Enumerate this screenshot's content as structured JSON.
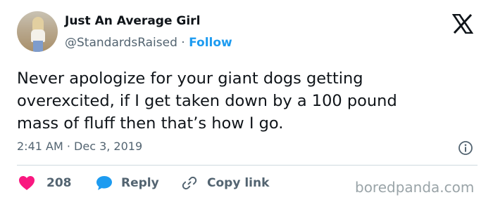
{
  "author": {
    "display_name": "Just An Average Girl",
    "handle": "@StandardsRaised",
    "separator": "·",
    "follow_label": "Follow",
    "avatar_icon": "profile-photo"
  },
  "tweet": {
    "lines": [
      "Never apologize for your giant dogs getting",
      "overexcited, if I get taken down by a 100 pound",
      "mass of fluff then that’s how I go."
    ],
    "timestamp": "2:41 AM · Dec 3, 2019"
  },
  "actions": {
    "like_count": "208",
    "reply_label": "Reply",
    "copy_link_label": "Copy link"
  },
  "icons": {
    "logo": "x-logo-icon",
    "info": "info-icon",
    "like": "heart-icon",
    "reply": "speech-bubble-icon",
    "copy": "link-icon"
  },
  "colors": {
    "like": "#f91880",
    "reply": "#1d9bf0",
    "follow": "#1d9bf0",
    "secondary_text": "#536471"
  },
  "watermark": "boredpanda.com"
}
